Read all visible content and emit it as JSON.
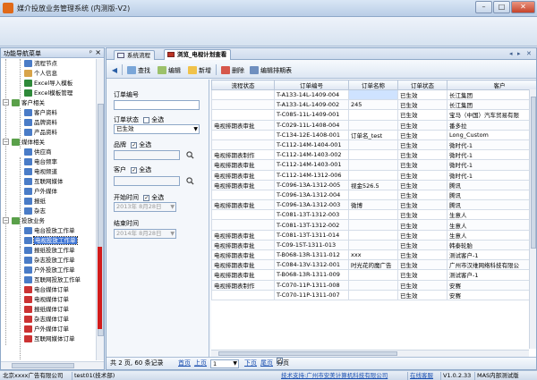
{
  "window": {
    "title": "媒介投放业务管理系统 (内测版-V2)",
    "min_label": "–",
    "max_label": "□",
    "close_label": "✕"
  },
  "nav_panel": {
    "title": "功能导航菜单",
    "pin_label": "ᵖ",
    "close_label": "×",
    "items": [
      {
        "label": "流程节点",
        "level": 2,
        "icon": "flow-icon"
      },
      {
        "label": "个人信息",
        "level": 2,
        "icon": "person-icon"
      },
      {
        "label": "Excel导入模板",
        "level": 2,
        "icon": "excel-icon"
      },
      {
        "label": "Excel模板管理",
        "level": 2,
        "icon": "excel-icon"
      },
      {
        "label": "客户相关",
        "level": 1,
        "icon": "folder-icon"
      },
      {
        "label": "客户资料",
        "level": 2,
        "icon": "customer-icon"
      },
      {
        "label": "品牌资料",
        "level": 2,
        "icon": "brand-icon"
      },
      {
        "label": "产品资料",
        "level": 2,
        "icon": "product-icon"
      },
      {
        "label": "媒体相关",
        "level": 1,
        "icon": "folder-icon"
      },
      {
        "label": "供应商",
        "level": 2,
        "icon": "supplier-icon"
      },
      {
        "label": "电台频率",
        "level": 2,
        "icon": "radio-icon"
      },
      {
        "label": "电视频道",
        "level": 2,
        "icon": "tv-icon"
      },
      {
        "label": "互联网媒体",
        "level": 2,
        "icon": "internet-icon"
      },
      {
        "label": "户外媒体",
        "level": 2,
        "icon": "outdoor-icon"
      },
      {
        "label": "报纸",
        "level": 2,
        "icon": "newspaper-icon"
      },
      {
        "label": "杂志",
        "level": 2,
        "icon": "magazine-icon"
      },
      {
        "label": "投放业务",
        "level": 1,
        "icon": "folder-icon"
      },
      {
        "label": "电台投放工作单",
        "level": 2,
        "icon": "radio-order-icon"
      },
      {
        "label": "电视投放工作单",
        "level": 2,
        "icon": "tv-order-icon",
        "selected": true
      },
      {
        "label": "报纸投放工作单",
        "level": 2,
        "icon": "newspaper-order-icon"
      },
      {
        "label": "杂志投放工作单",
        "level": 2,
        "icon": "magazine-order-icon"
      },
      {
        "label": "户外投放工作单",
        "level": 2,
        "icon": "outdoor-order-icon"
      },
      {
        "label": "互联网投放工作单",
        "level": 2,
        "icon": "internet-order-icon"
      },
      {
        "label": "电台媒体订单",
        "level": 2,
        "icon": "order-icon"
      },
      {
        "label": "电视媒体订单",
        "level": 2,
        "icon": "order-icon"
      },
      {
        "label": "报纸媒体订单",
        "level": 2,
        "icon": "order-icon"
      },
      {
        "label": "杂志媒体订单",
        "level": 2,
        "icon": "order-icon"
      },
      {
        "label": "户外媒体订单",
        "level": 2,
        "icon": "order-icon"
      },
      {
        "label": "互联网媒体订单",
        "level": 2,
        "icon": "order-icon"
      }
    ]
  },
  "tabs": [
    {
      "label": "系统流程",
      "active": false
    },
    {
      "label": "浏览_电视计划查看",
      "active": true
    }
  ],
  "toolbar": {
    "back_label": "◀",
    "search_label": "查找",
    "edit_label": "编辑",
    "add_label": "新增",
    "delete_label": "删除",
    "edit_schedule_label": "编辑排期表"
  },
  "filter": {
    "order_no_label": "订单编号",
    "order_no_value": "",
    "order_status_label": "订单状态",
    "select_all_label": "全选",
    "order_status_value": "已生效",
    "brand_label": "品牌",
    "customer_label": "客户",
    "start_time_label": "开始时间",
    "start_time_value": "2013年 8月28日",
    "end_time_label": "结束时间",
    "end_time_value": "2014年 8月28日"
  },
  "grid": {
    "columns": [
      "流程状态",
      "订单编号",
      "订单名称",
      "订单状态",
      "客户"
    ],
    "rows": [
      [
        "",
        "T-A133-14L-1409-004",
        "",
        "已生效",
        "长江集团"
      ],
      [
        "",
        "T-A133-14L-1409-002",
        "245",
        "已生效",
        "长江集团"
      ],
      [
        "",
        "T-C085-11L-1409-001",
        "",
        "已生效",
        "宝马（中国）汽车贸易有限"
      ],
      [
        "电视排期表审批",
        "T-C029-11L-1408-004",
        "",
        "已生效",
        "番多拉"
      ],
      [
        "",
        "T-C134-12E-1408-001",
        "订单名_test",
        "已生效",
        "Long_Custom"
      ],
      [
        "",
        "T-C112-14M-1404-001",
        "",
        "已生效",
        "微时代-1"
      ],
      [
        "电视排期表制作",
        "T-C112-14M-1403-002",
        "",
        "已生效",
        "微时代-1"
      ],
      [
        "电视排期表审批",
        "T-C112-14M-1403-001",
        "",
        "已生效",
        "微时代-1"
      ],
      [
        "电视排期表审批",
        "T-C112-14M-1312-006",
        "",
        "已生效",
        "微时代-1"
      ],
      [
        "电视排期表审批",
        "T-C096-13A-1312-005",
        "视金526.5",
        "已生效",
        "腾讯"
      ],
      [
        "",
        "T-C096-13A-1312-004",
        "",
        "已生效",
        "腾讯"
      ],
      [
        "电视排期表审批",
        "T-C096-13A-1312-003",
        "微博",
        "已生效",
        "腾讯"
      ],
      [
        "",
        "T-C081-13T-1312-003",
        "",
        "已生效",
        "生意人"
      ],
      [
        "",
        "T-C081-13T-1312-002",
        "",
        "已生效",
        "生意人"
      ],
      [
        "电视排期表审批",
        "T-C081-13T-1311-014",
        "",
        "已生效",
        "生意人"
      ],
      [
        "电视排期表审批",
        "T-C09-15T-1311-013",
        "",
        "已生效",
        "韩泰轮胎"
      ],
      [
        "电视排期表审批",
        "T-B068-13R-1311-012",
        "xxx",
        "已生效",
        "测试客户-1"
      ],
      [
        "电视排期表审批",
        "T-C084-13V-1312-001",
        "时光花的魔广告",
        "已生效",
        "广州市汉维网络科技有限公"
      ],
      [
        "电视排期表审批",
        "T-B068-13R-1311-009",
        "",
        "已生效",
        "测试客户-1"
      ],
      [
        "电视排期表制作",
        "T-C070-11P-1311-008",
        "",
        "已生效",
        "安赛"
      ],
      [
        "",
        "T-C070-11P-1311-007",
        "",
        "已生效",
        "安赛"
      ]
    ]
  },
  "pager": {
    "summary": "共 2 页, 60 条记录",
    "first": "首页",
    "prev": "上页",
    "page_value": "1",
    "next": "下页",
    "last": "尾页",
    "paging_label": "分页"
  },
  "statusbar": {
    "company": "北京xxxx广告有限公司",
    "user": "test01(技术部)",
    "tech_support": "技术支持:广州市安美计算机科技有限公司",
    "online_service": "在线客服",
    "version": "V1.0.2.33",
    "server": "MAS内部测试版"
  },
  "colors": {
    "accent": "#3c74d6",
    "link": "#1a4fb0",
    "highlight_mark": "#d21c1c"
  }
}
